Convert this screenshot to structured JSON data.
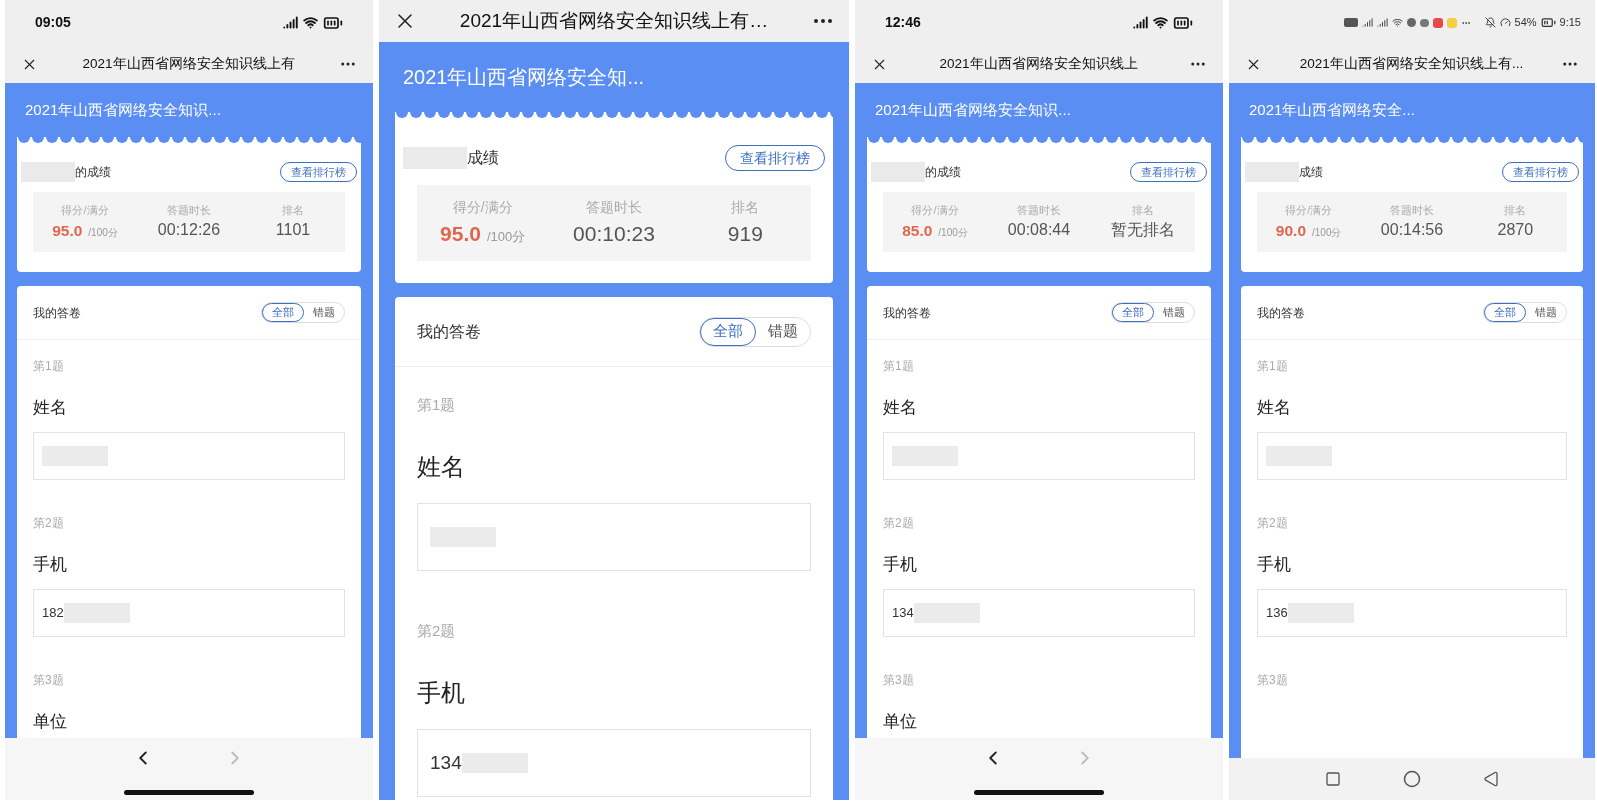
{
  "phones": [
    {
      "kind": "ios",
      "status_bar": {
        "time": "09:05"
      },
      "nav_title": "2021年山西省网络安全知识线上有",
      "header_title": "2021年山西省网络安全知识...",
      "score_card": {
        "name_suffix": "的成绩",
        "ranking_button": "查看排行榜",
        "stats": [
          {
            "kind": "score",
            "label": "得分/满分",
            "value": "95.0",
            "unit": "/100分"
          },
          {
            "kind": "plain",
            "label": "答题时长",
            "value": "00:12:26"
          },
          {
            "kind": "plain",
            "label": "排名",
            "value": "1101"
          }
        ]
      },
      "answers": {
        "title": "我的答卷",
        "tabs": [
          {
            "label": "全部",
            "selected": true
          },
          {
            "label": "错题",
            "selected": false
          }
        ],
        "questions": [
          {
            "number": "第1题",
            "title": "姓名",
            "redacted": true
          },
          {
            "number": "第2题",
            "title": "手机",
            "answer": "182",
            "redacted": true
          },
          {
            "number": "第3题",
            "title": "单位"
          }
        ]
      }
    },
    {
      "kind": "cropped",
      "nav_title": "2021年山西省网络安全知识线上有…",
      "header_title": "2021年山西省网络安全知...",
      "score_card": {
        "name_suffix": "成绩",
        "ranking_button": "查看排行榜",
        "stats": [
          {
            "kind": "score",
            "label": "得分/满分",
            "value": "95.0",
            "unit": "/100分"
          },
          {
            "kind": "plain",
            "label": "答题时长",
            "value": "00:10:23"
          },
          {
            "kind": "plain",
            "label": "排名",
            "value": "919"
          }
        ]
      },
      "answers": {
        "title": "我的答卷",
        "tabs": [
          {
            "label": "全部",
            "selected": true
          },
          {
            "label": "错题",
            "selected": false
          }
        ],
        "questions": [
          {
            "number": "第1题",
            "title": "姓名",
            "redacted": true
          },
          {
            "number": "第2题",
            "title": "手机",
            "answer": "134",
            "redacted": true
          }
        ]
      }
    },
    {
      "kind": "ios",
      "status_bar": {
        "time": "12:46"
      },
      "nav_title": "2021年山西省网络安全知识线上",
      "header_title": "2021年山西省网络安全知识...",
      "score_card": {
        "name_suffix": "的成绩",
        "ranking_button": "查看排行榜",
        "stats": [
          {
            "kind": "score",
            "label": "得分/满分",
            "value": "85.0",
            "unit": "/100分"
          },
          {
            "kind": "plain",
            "label": "答题时长",
            "value": "00:08:44"
          },
          {
            "kind": "plain",
            "label": "排名",
            "value": "暂无排名"
          }
        ]
      },
      "answers": {
        "title": "我的答卷",
        "tabs": [
          {
            "label": "全部",
            "selected": true
          },
          {
            "label": "错题",
            "selected": false
          }
        ],
        "questions": [
          {
            "number": "第1题",
            "title": "姓名",
            "redacted": true
          },
          {
            "number": "第2题",
            "title": "手机",
            "answer": "134",
            "redacted": true
          },
          {
            "number": "第3题",
            "title": "单位"
          }
        ]
      }
    },
    {
      "kind": "android",
      "status_bar": {
        "battery": "54%",
        "time": "9:15"
      },
      "nav_title": "2021年山西省网络安全知识线上有...",
      "header_title": "2021年山西省网络安全...",
      "score_card": {
        "name_suffix": "成绩",
        "ranking_button": "查看排行榜",
        "stats": [
          {
            "kind": "score",
            "label": "得分/满分",
            "value": "90.0",
            "unit": "/100分"
          },
          {
            "kind": "plain",
            "label": "答题时长",
            "value": "00:14:56"
          },
          {
            "kind": "plain",
            "label": "排名",
            "value": "2870"
          }
        ]
      },
      "answers": {
        "title": "我的答卷",
        "tabs": [
          {
            "label": "全部",
            "selected": true
          },
          {
            "label": "错题",
            "selected": false
          }
        ],
        "questions": [
          {
            "number": "第1题",
            "title": "姓名",
            "redacted": true
          },
          {
            "number": "第2题",
            "title": "手机",
            "answer": "136",
            "redacted": true
          },
          {
            "number": "第3题"
          }
        ]
      }
    }
  ]
}
